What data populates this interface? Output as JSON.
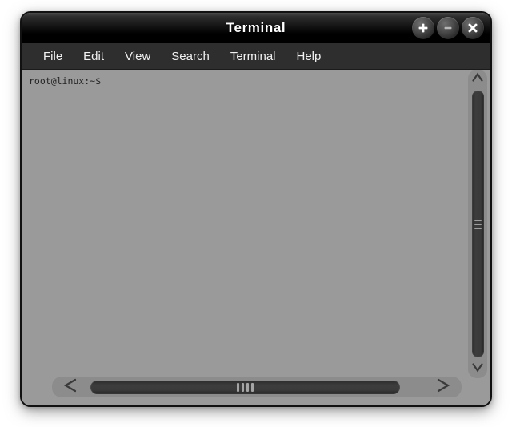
{
  "window": {
    "title": "Terminal",
    "buttons": [
      {
        "name": "maximize-button",
        "icon": "plus-icon",
        "label": "+"
      },
      {
        "name": "minimize-button",
        "icon": "minus-icon",
        "label": "−"
      },
      {
        "name": "close-button",
        "icon": "close-icon",
        "label": "×"
      }
    ]
  },
  "menubar": {
    "items": [
      {
        "label": "File"
      },
      {
        "label": "Edit"
      },
      {
        "label": "View"
      },
      {
        "label": "Search"
      },
      {
        "label": "Terminal"
      },
      {
        "label": "Help"
      }
    ]
  },
  "terminal": {
    "prompt": "root@linux:~$",
    "background_color": "#9a9a9a",
    "text_color": "#232323"
  },
  "scrollbars": {
    "vertical": {
      "up_arrow_icon": "chevron-up-icon",
      "down_arrow_icon": "chevron-down-icon",
      "grip_lines": 3
    },
    "horizontal": {
      "left_arrow_icon": "chevron-left-icon",
      "right_arrow_icon": "chevron-right-icon",
      "grip_lines": 4
    }
  },
  "colors": {
    "titlebar": "#000000",
    "menubar": "#2e2e2e",
    "window_body": "#9a9a9a",
    "scroll_track": "#8c8c8c",
    "scroll_thumb": "#3a3a3a",
    "menu_text": "#f2f2f2"
  }
}
